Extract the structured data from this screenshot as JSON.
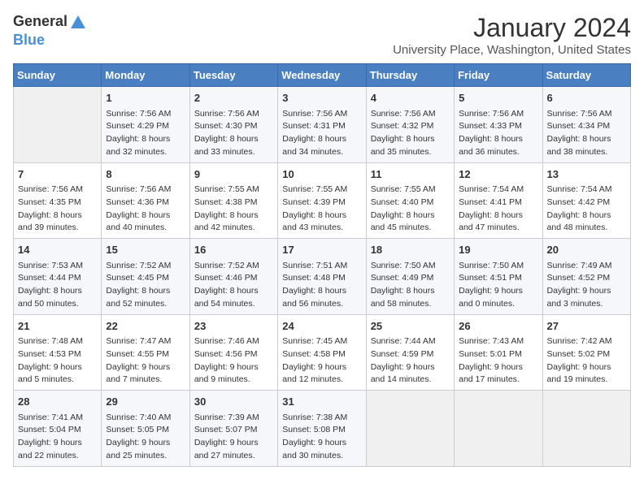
{
  "logo": {
    "general": "General",
    "blue": "Blue"
  },
  "title": "January 2024",
  "location": "University Place, Washington, United States",
  "days_header": [
    "Sunday",
    "Monday",
    "Tuesday",
    "Wednesday",
    "Thursday",
    "Friday",
    "Saturday"
  ],
  "weeks": [
    [
      {
        "day": "",
        "content": ""
      },
      {
        "day": "1",
        "content": "Sunrise: 7:56 AM\nSunset: 4:29 PM\nDaylight: 8 hours\nand 32 minutes."
      },
      {
        "day": "2",
        "content": "Sunrise: 7:56 AM\nSunset: 4:30 PM\nDaylight: 8 hours\nand 33 minutes."
      },
      {
        "day": "3",
        "content": "Sunrise: 7:56 AM\nSunset: 4:31 PM\nDaylight: 8 hours\nand 34 minutes."
      },
      {
        "day": "4",
        "content": "Sunrise: 7:56 AM\nSunset: 4:32 PM\nDaylight: 8 hours\nand 35 minutes."
      },
      {
        "day": "5",
        "content": "Sunrise: 7:56 AM\nSunset: 4:33 PM\nDaylight: 8 hours\nand 36 minutes."
      },
      {
        "day": "6",
        "content": "Sunrise: 7:56 AM\nSunset: 4:34 PM\nDaylight: 8 hours\nand 38 minutes."
      }
    ],
    [
      {
        "day": "7",
        "content": "Sunrise: 7:56 AM\nSunset: 4:35 PM\nDaylight: 8 hours\nand 39 minutes."
      },
      {
        "day": "8",
        "content": "Sunrise: 7:56 AM\nSunset: 4:36 PM\nDaylight: 8 hours\nand 40 minutes."
      },
      {
        "day": "9",
        "content": "Sunrise: 7:55 AM\nSunset: 4:38 PM\nDaylight: 8 hours\nand 42 minutes."
      },
      {
        "day": "10",
        "content": "Sunrise: 7:55 AM\nSunset: 4:39 PM\nDaylight: 8 hours\nand 43 minutes."
      },
      {
        "day": "11",
        "content": "Sunrise: 7:55 AM\nSunset: 4:40 PM\nDaylight: 8 hours\nand 45 minutes."
      },
      {
        "day": "12",
        "content": "Sunrise: 7:54 AM\nSunset: 4:41 PM\nDaylight: 8 hours\nand 47 minutes."
      },
      {
        "day": "13",
        "content": "Sunrise: 7:54 AM\nSunset: 4:42 PM\nDaylight: 8 hours\nand 48 minutes."
      }
    ],
    [
      {
        "day": "14",
        "content": "Sunrise: 7:53 AM\nSunset: 4:44 PM\nDaylight: 8 hours\nand 50 minutes."
      },
      {
        "day": "15",
        "content": "Sunrise: 7:52 AM\nSunset: 4:45 PM\nDaylight: 8 hours\nand 52 minutes."
      },
      {
        "day": "16",
        "content": "Sunrise: 7:52 AM\nSunset: 4:46 PM\nDaylight: 8 hours\nand 54 minutes."
      },
      {
        "day": "17",
        "content": "Sunrise: 7:51 AM\nSunset: 4:48 PM\nDaylight: 8 hours\nand 56 minutes."
      },
      {
        "day": "18",
        "content": "Sunrise: 7:50 AM\nSunset: 4:49 PM\nDaylight: 8 hours\nand 58 minutes."
      },
      {
        "day": "19",
        "content": "Sunrise: 7:50 AM\nSunset: 4:51 PM\nDaylight: 9 hours\nand 0 minutes."
      },
      {
        "day": "20",
        "content": "Sunrise: 7:49 AM\nSunset: 4:52 PM\nDaylight: 9 hours\nand 3 minutes."
      }
    ],
    [
      {
        "day": "21",
        "content": "Sunrise: 7:48 AM\nSunset: 4:53 PM\nDaylight: 9 hours\nand 5 minutes."
      },
      {
        "day": "22",
        "content": "Sunrise: 7:47 AM\nSunset: 4:55 PM\nDaylight: 9 hours\nand 7 minutes."
      },
      {
        "day": "23",
        "content": "Sunrise: 7:46 AM\nSunset: 4:56 PM\nDaylight: 9 hours\nand 9 minutes."
      },
      {
        "day": "24",
        "content": "Sunrise: 7:45 AM\nSunset: 4:58 PM\nDaylight: 9 hours\nand 12 minutes."
      },
      {
        "day": "25",
        "content": "Sunrise: 7:44 AM\nSunset: 4:59 PM\nDaylight: 9 hours\nand 14 minutes."
      },
      {
        "day": "26",
        "content": "Sunrise: 7:43 AM\nSunset: 5:01 PM\nDaylight: 9 hours\nand 17 minutes."
      },
      {
        "day": "27",
        "content": "Sunrise: 7:42 AM\nSunset: 5:02 PM\nDaylight: 9 hours\nand 19 minutes."
      }
    ],
    [
      {
        "day": "28",
        "content": "Sunrise: 7:41 AM\nSunset: 5:04 PM\nDaylight: 9 hours\nand 22 minutes."
      },
      {
        "day": "29",
        "content": "Sunrise: 7:40 AM\nSunset: 5:05 PM\nDaylight: 9 hours\nand 25 minutes."
      },
      {
        "day": "30",
        "content": "Sunrise: 7:39 AM\nSunset: 5:07 PM\nDaylight: 9 hours\nand 27 minutes."
      },
      {
        "day": "31",
        "content": "Sunrise: 7:38 AM\nSunset: 5:08 PM\nDaylight: 9 hours\nand 30 minutes."
      },
      {
        "day": "",
        "content": ""
      },
      {
        "day": "",
        "content": ""
      },
      {
        "day": "",
        "content": ""
      }
    ]
  ]
}
